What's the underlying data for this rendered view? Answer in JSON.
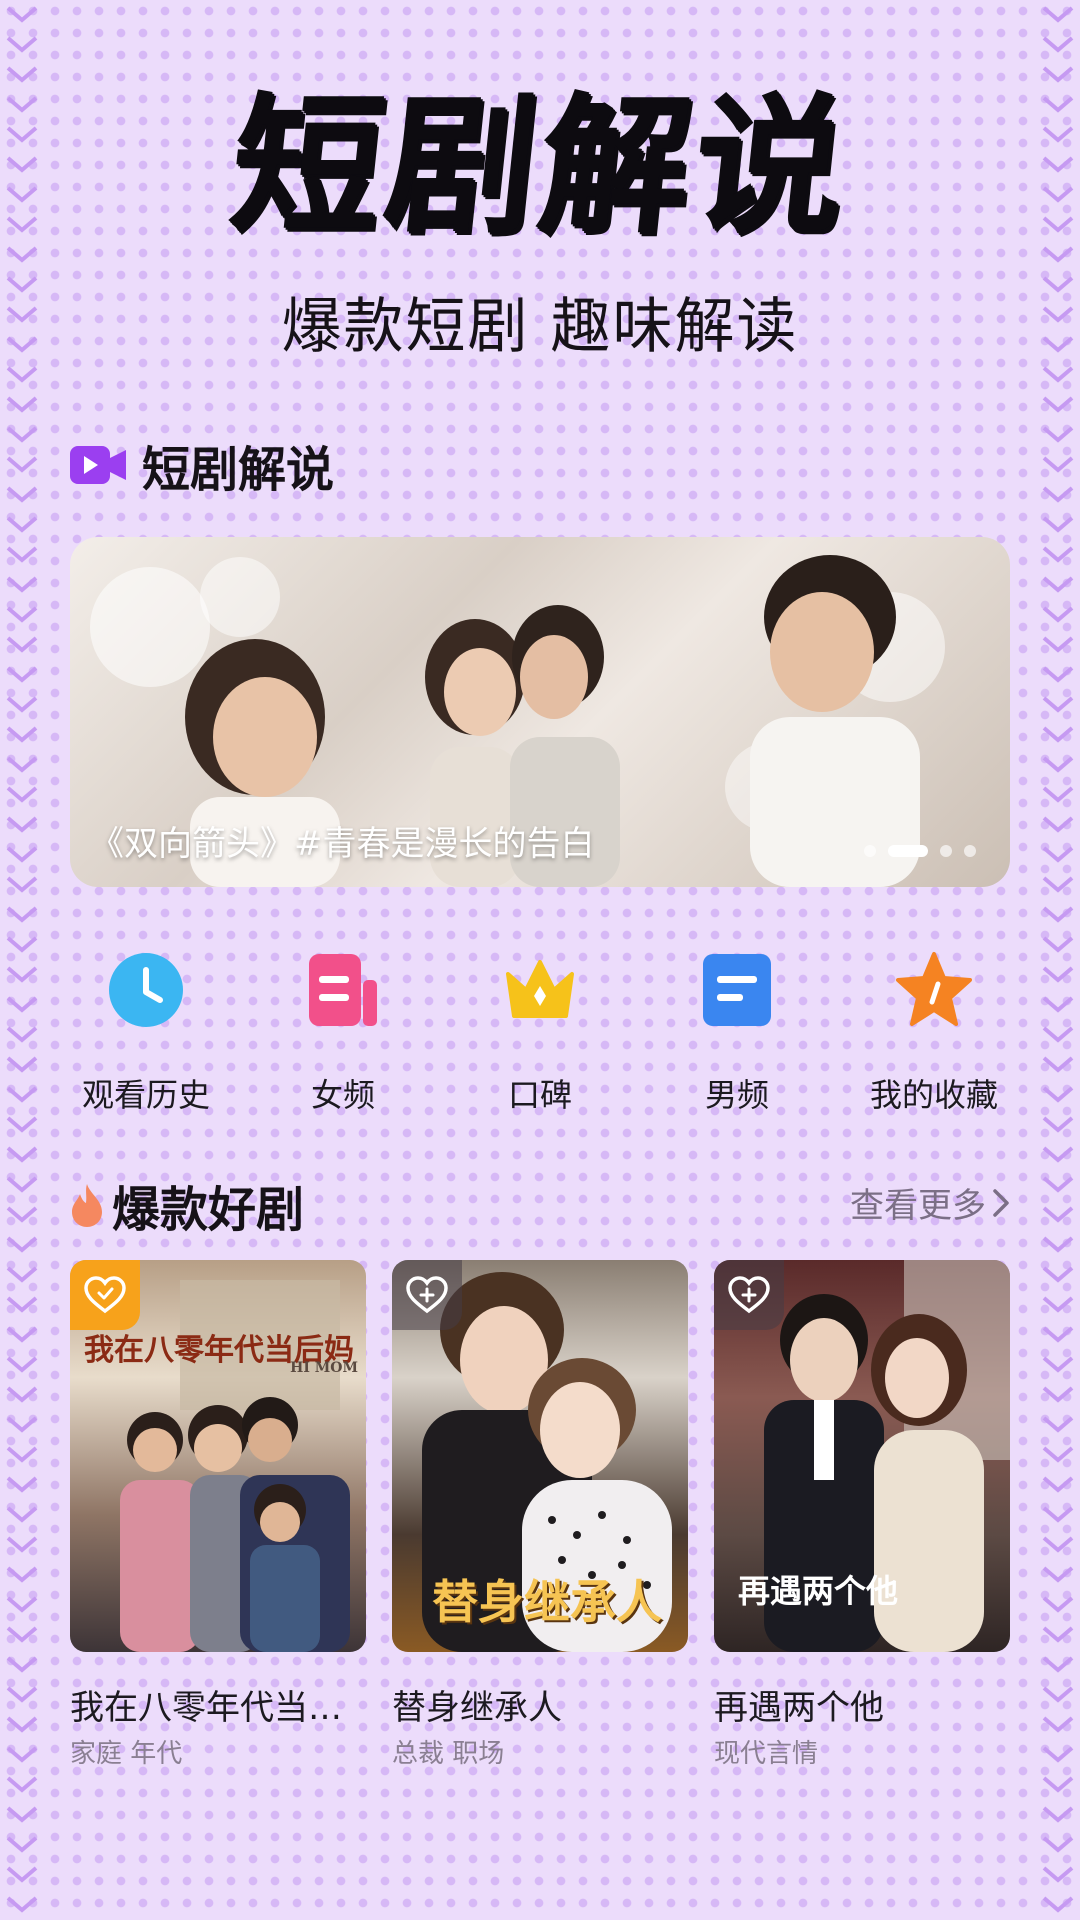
{
  "hero": {
    "title": "短剧解说",
    "subtitle": "爆款短剧 趣味解读"
  },
  "section1": {
    "title": "短剧解说",
    "icon": "video-camera-icon"
  },
  "banner": {
    "caption": "《双向箭头》#青春是漫长的告白",
    "page_count": 4,
    "active_index": 1
  },
  "quick_entries": [
    {
      "label": "观看历史",
      "icon": "clock-icon",
      "color": "#3bb6f2"
    },
    {
      "label": "女频",
      "icon": "female-channel-icon",
      "color": "#f2508a"
    },
    {
      "label": "口碑",
      "icon": "crown-icon",
      "color": "#f6c21a"
    },
    {
      "label": "男频",
      "icon": "male-channel-icon",
      "color": "#3a86f0"
    },
    {
      "label": "我的收藏",
      "icon": "star-icon",
      "color": "#f58322"
    }
  ],
  "section2": {
    "title": "爆款好剧",
    "icon": "fire-icon",
    "more_label": "查看更多"
  },
  "cards": [
    {
      "title": "我在八零年代当后妈",
      "tags": "家庭  年代",
      "poster_text": "我在八零年代当后妈",
      "poster_sub": "HI MOM",
      "favorited": true
    },
    {
      "title": "替身继承人",
      "tags": "总裁  职场",
      "poster_text": "替身继承人",
      "poster_sub": "",
      "favorited": false
    },
    {
      "title": "再遇两个他",
      "tags": "现代言情",
      "poster_text": "再遇两个他",
      "poster_sub": "",
      "favorited": false
    }
  ],
  "colors": {
    "accent": "#9b3ff0",
    "background": "#ecdcfb"
  }
}
